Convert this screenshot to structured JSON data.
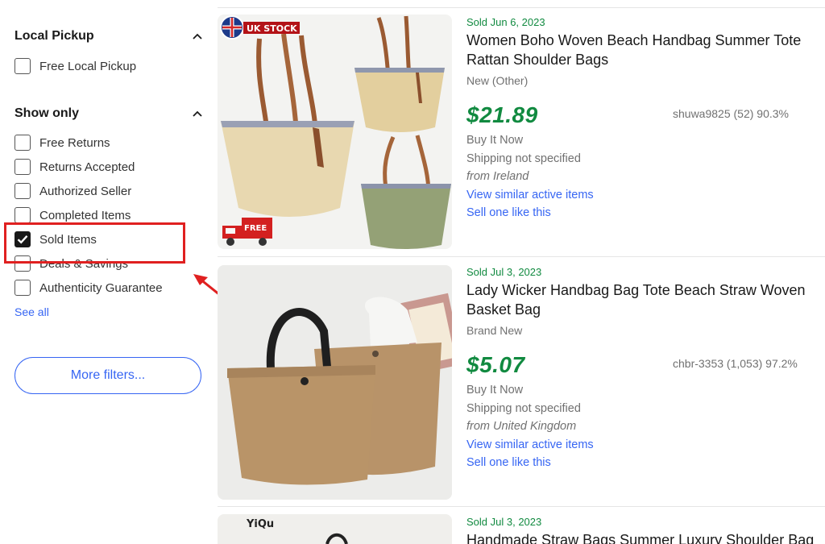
{
  "filters": {
    "local_pickup": {
      "title": "Local Pickup",
      "options": [
        {
          "label": "Free Local Pickup",
          "checked": false
        }
      ]
    },
    "show_only": {
      "title": "Show only",
      "options": [
        {
          "label": "Free Returns",
          "checked": false
        },
        {
          "label": "Returns Accepted",
          "checked": false
        },
        {
          "label": "Authorized Seller",
          "checked": false
        },
        {
          "label": "Completed Items",
          "checked": false
        },
        {
          "label": "Sold Items",
          "checked": true
        },
        {
          "label": "Deals & Savings",
          "checked": false
        },
        {
          "label": "Authenticity Guarantee",
          "checked": false
        }
      ]
    },
    "see_all": "See all",
    "more_filters": "More filters..."
  },
  "listings": [
    {
      "sold_date": "Sold Jun 6, 2023",
      "title_line1": "Women Boho Woven Beach Handbag Summer Tote",
      "title_line2": "Rattan Shoulder Bags",
      "condition": "New (Other)",
      "price": "$21.89",
      "seller": "shuwa9825 (52) 90.3%",
      "format": "Buy It Now",
      "shipping": "Shipping not specified",
      "location": "from Ireland",
      "link_similar": "View similar active items",
      "link_sell": "Sell one like this",
      "badge_top": "UK STOCK",
      "badge_bottom": "FREE"
    },
    {
      "sold_date": "Sold Jul 3, 2023",
      "title_line1": "Lady Wicker Handbag Bag Tote Beach Straw Woven",
      "title_line2": "Basket Bag",
      "condition": "Brand New",
      "price": "$5.07",
      "seller": "chbr-3353 (1,053) 97.2%",
      "format": "Buy It Now",
      "shipping": "Shipping not specified",
      "location": "from United Kingdom",
      "link_similar": "View similar active items",
      "link_sell": "Sell one like this"
    },
    {
      "sold_date": "Sold Jul 3, 2023",
      "title_line1": "Handmade Straw Bags Summer Luxury Shoulder Bag",
      "brand_text": "YiQu"
    }
  ],
  "colors": {
    "sold_green": "#118a40",
    "link_blue": "#3665f3",
    "highlight_red": "#e02020"
  },
  "icons": [
    "chevron-up-icon",
    "checkmark-icon",
    "arrow-pointer"
  ]
}
